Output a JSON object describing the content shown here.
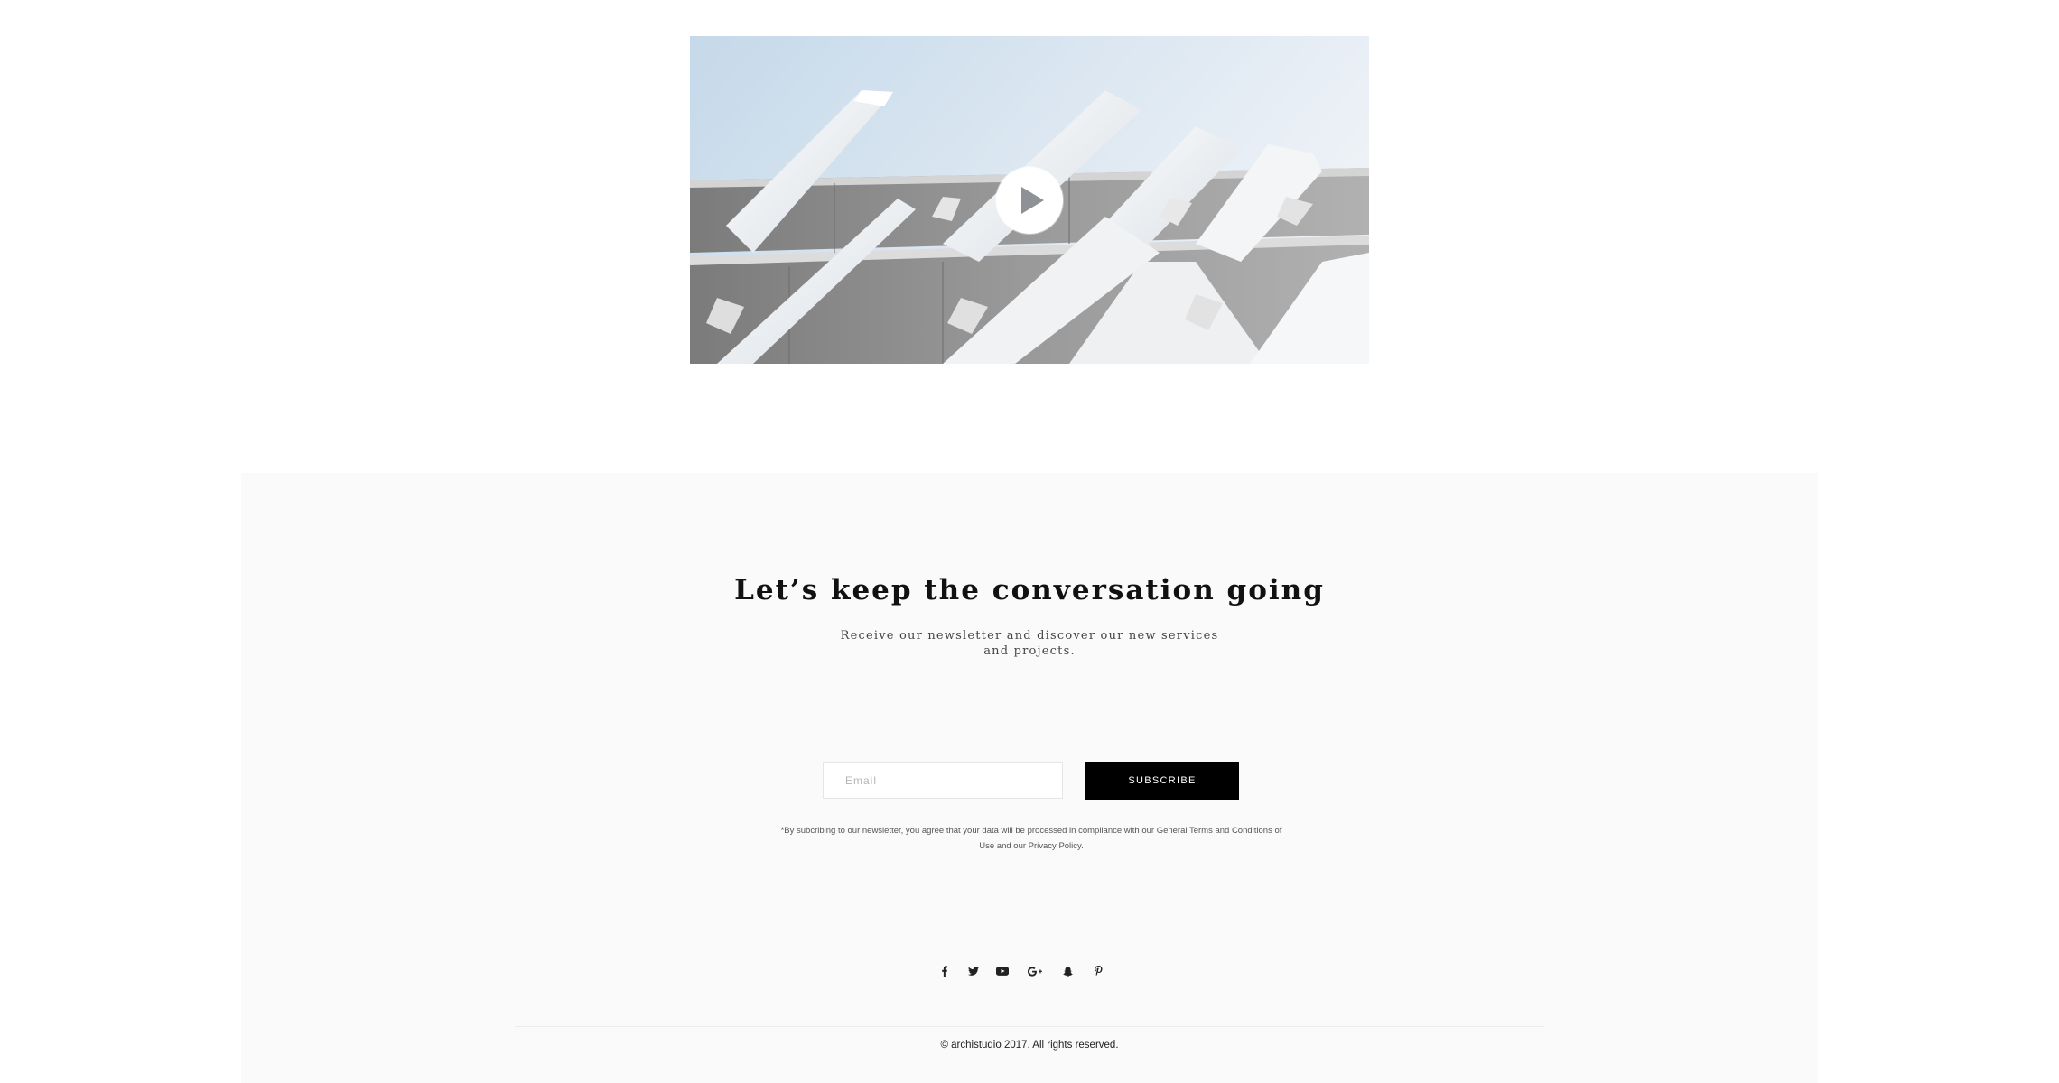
{
  "video": {
    "play_icon": "play-icon"
  },
  "newsletter": {
    "headline": "Let’s keep the conversation going",
    "subline": "Receive our newsletter and discover our new services and projects.",
    "email_placeholder": "Email",
    "email_value": "",
    "subscribe_label": "SUBSCRIBE",
    "disclaimer": "*By subcribing to our newsletter, you agree that your data will be processed in compliance with our General Terms and Conditions of Use and our Privacy Policy."
  },
  "social": {
    "icons": [
      "facebook-icon",
      "twitter-icon",
      "youtube-icon",
      "google-plus-icon",
      "snapchat-icon",
      "pinterest-icon"
    ]
  },
  "footer": {
    "copyright": "© archistudio 2017. All rights reserved."
  },
  "colors": {
    "panel_background": "#fafafa",
    "button_background": "#000000",
    "button_text": "#ffffff",
    "text": "#111111"
  }
}
